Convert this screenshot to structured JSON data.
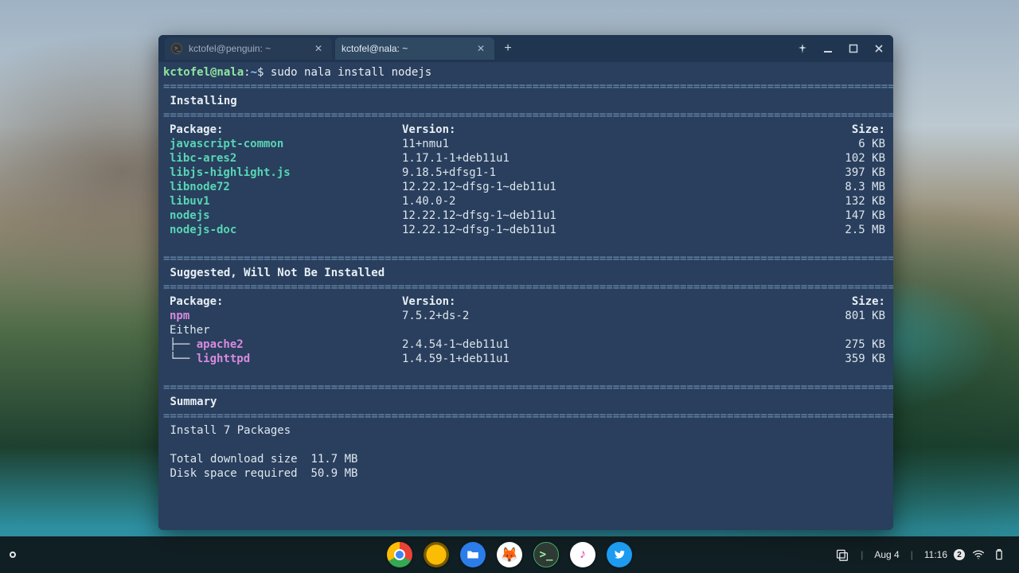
{
  "tabs": {
    "inactive_label": "kctofel@penguin: ~",
    "active_label": "kctofel@nala: ~"
  },
  "window_controls": {
    "pin": "pin-icon",
    "minimize": "minimize-icon",
    "maximize": "maximize-icon",
    "close": "close-icon"
  },
  "prompt": {
    "userhost": "kctofel@nala",
    "path": "~",
    "symbol": "$",
    "command": "sudo nala install nodejs"
  },
  "sections": {
    "installing_title": "Installing",
    "suggested_title": "Suggested, Will Not Be Installed",
    "summary_title": "Summary",
    "col_package": "Package:",
    "col_version": "Version:",
    "col_size": "Size:",
    "either_label": "Either"
  },
  "installing": [
    {
      "pkg": "javascript-common",
      "ver": "11+nmu1",
      "size": "6 KB"
    },
    {
      "pkg": "libc-ares2",
      "ver": "1.17.1-1+deb11u1",
      "size": "102 KB"
    },
    {
      "pkg": "libjs-highlight.js",
      "ver": "9.18.5+dfsg1-1",
      "size": "397 KB"
    },
    {
      "pkg": "libnode72",
      "ver": "12.22.12~dfsg-1~deb11u1",
      "size": "8.3 MB"
    },
    {
      "pkg": "libuv1",
      "ver": "1.40.0-2",
      "size": "132 KB"
    },
    {
      "pkg": "nodejs",
      "ver": "12.22.12~dfsg-1~deb11u1",
      "size": "147 KB"
    },
    {
      "pkg": "nodejs-doc",
      "ver": "12.22.12~dfsg-1~deb11u1",
      "size": "2.5 MB"
    }
  ],
  "suggested_primary": {
    "pkg": "npm",
    "ver": "7.5.2+ds-2",
    "size": "801 KB"
  },
  "suggested_either": [
    {
      "pkg": "apache2",
      "ver": "2.4.54-1~deb11u1",
      "size": "275 KB"
    },
    {
      "pkg": "lighttpd",
      "ver": "1.4.59-1+deb11u1",
      "size": "359 KB"
    }
  ],
  "summary": {
    "install_line": "Install 7 Packages",
    "download_label": "Total download size",
    "download_value": "11.7 MB",
    "disk_label": "Disk space required",
    "disk_value": "50.9 MB"
  },
  "divider": "==============================================================================================================",
  "subdivider": "──────────────────────────────────────────────────────────────────────────────────────────────────────────────",
  "tree_branch": "├──",
  "tree_end": "└──",
  "shelf": {
    "date": "Aug 4",
    "time": "11:16",
    "notif_count": "2"
  }
}
